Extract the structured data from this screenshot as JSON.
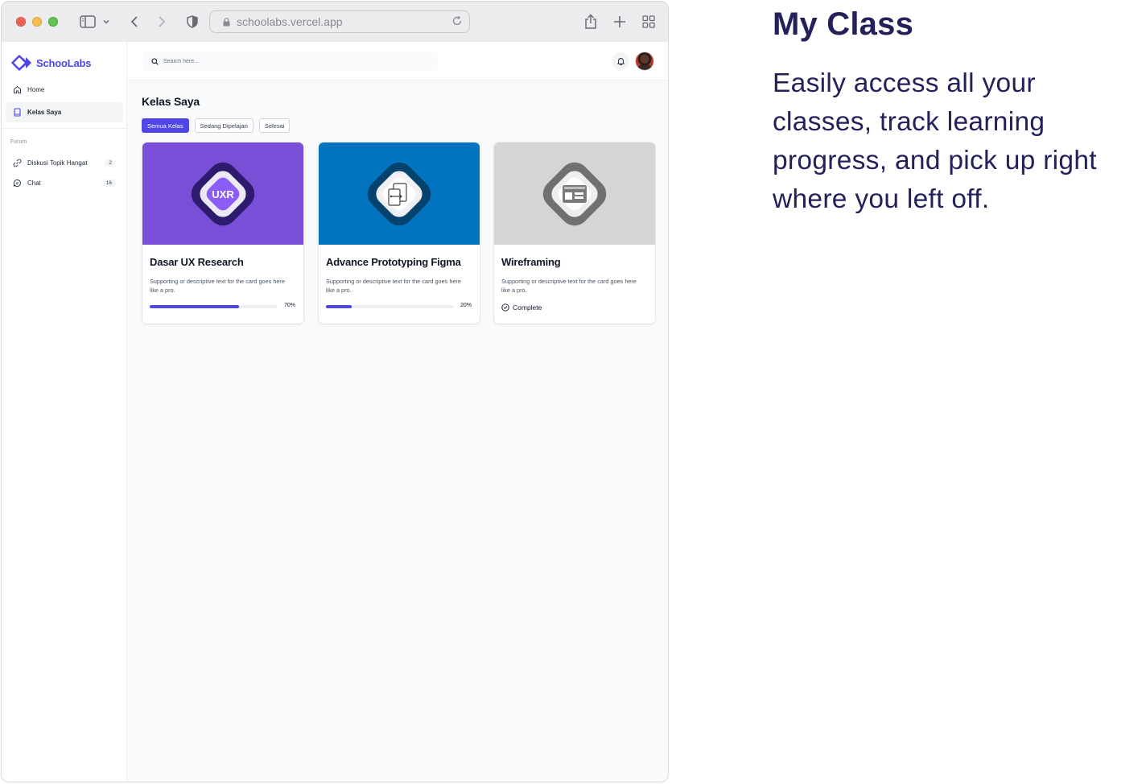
{
  "browser": {
    "url": "schoolabs.vercel.app"
  },
  "brand": {
    "name": "SchooLabs",
    "color": "#4f46e5"
  },
  "sidebar": {
    "items": [
      {
        "label": "Home",
        "icon": "home-icon"
      },
      {
        "label": "Kelas Saya",
        "icon": "book-icon",
        "active": true
      }
    ],
    "section_title": "Forum",
    "forum_items": [
      {
        "label": "Diskusi Topik Hangat",
        "icon": "link-icon",
        "count": "2"
      },
      {
        "label": "Chat",
        "icon": "chat-icon",
        "count": "16"
      }
    ]
  },
  "topbar": {
    "search_placeholder": "Search here..."
  },
  "main": {
    "title": "Kelas Saya",
    "tabs": [
      {
        "label": "Semua Kelas",
        "active": true
      },
      {
        "label": "Sedang Dipelajari"
      },
      {
        "label": "Selesai"
      }
    ],
    "cards": [
      {
        "title": "Dasar UX Research",
        "description": "Supporting or descriptive text for the card goes here like a pro.",
        "badge_text": "UXR",
        "media_color": "#7a4fd8",
        "progress": 0.7,
        "progress_label": "70%"
      },
      {
        "title": "Advance Prototyping Figma",
        "description": "Supporting or descriptive text for the card goes here like a pro.",
        "media_color": "#0274bf",
        "progress": 0.2,
        "progress_label": "20%"
      },
      {
        "title": "Wireframing",
        "description": "Supporting or descriptive text for the card goes here like a pro.",
        "media_color": "#d5d5d5",
        "status": "Complete"
      }
    ]
  },
  "promo": {
    "headline": "My Class",
    "body": "Easily access all your classes, track learning progress, and pick up right where you left off.",
    "text_color": "#24205a"
  }
}
